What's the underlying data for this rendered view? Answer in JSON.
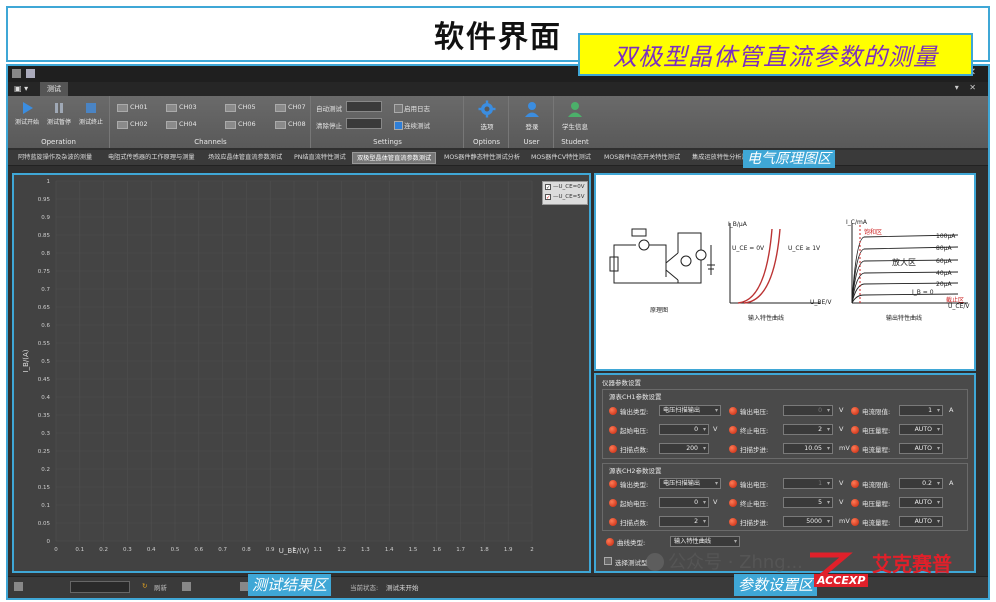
{
  "banner": {
    "title": "软件界面"
  },
  "window": {
    "menu_tab": "测试",
    "controls": "— ⧉ ✕",
    "tab_right": "▾ ✕"
  },
  "ribbon": {
    "operation": {
      "title": "Operation",
      "start": "测试开始",
      "pause": "测试暂停",
      "stop": "测试终止"
    },
    "channels": {
      "title": "Channels",
      "items": [
        "CH01",
        "CH02",
        "CH03",
        "CH04",
        "CH05",
        "CH06",
        "CH07",
        "CH08"
      ]
    },
    "settings": {
      "title": "Settings",
      "auto_test": "自动测试",
      "clear_stop": "清除停止",
      "enable_log": "启用日志",
      "continuous": "连续测试"
    },
    "options": {
      "title": "Options",
      "label": "选项"
    },
    "user": {
      "title": "User",
      "label": "登录"
    },
    "student": {
      "title": "Student",
      "label": "学生信息"
    }
  },
  "headline": "双极型晶体管直流参数的测量",
  "exp_tabs": [
    "阿特蓝旋操作及杂波的测量",
    "电阻式传感器的工作原理与测量",
    "场效应晶体管直流参数测试",
    "PN结直流特性测试",
    "双极型晶体管直流参数测试",
    "MOS器件静态特性测试分析",
    "MOS器件CV特性测试",
    "MOS器件动态开关特性测试",
    "集成运放特性分析测试"
  ],
  "callouts": {
    "circuit": "电气原理图区",
    "results": "测试结果区",
    "params": "参数设置区"
  },
  "plot": {
    "legend": [
      "—U_CE=0V",
      "—U_CE=5V"
    ],
    "legend_colors": [
      "#bbbbbb",
      "#d24040"
    ]
  },
  "chart_data": {
    "type": "line",
    "title": "",
    "xlabel": "U_BE/(V)",
    "ylabel": "I_B/(A)",
    "xlim": [
      0,
      2
    ],
    "ylim": [
      0,
      1
    ],
    "x_ticks": [
      "0",
      "0.1",
      "0.2",
      "0.3",
      "0.4",
      "0.5",
      "0.6",
      "0.7",
      "0.8",
      "0.9",
      "1",
      "1.1",
      "1.2",
      "1.3",
      "1.4",
      "1.5",
      "1.6",
      "1.7",
      "1.8",
      "1.9",
      "2"
    ],
    "y_ticks": [
      "0",
      "0.05",
      "0.1",
      "0.15",
      "0.2",
      "0.25",
      "0.3",
      "0.35",
      "0.4",
      "0.45",
      "0.5",
      "0.55",
      "0.6",
      "0.65",
      "0.7",
      "0.75",
      "0.8",
      "0.85",
      "0.9",
      "0.95",
      "1"
    ],
    "series": [
      {
        "name": "U_CE=0V",
        "color": "#bbbbbb",
        "values": []
      },
      {
        "name": "U_CE=5V",
        "color": "#d24040",
        "values": []
      }
    ],
    "grid": true,
    "legend_position": "top-right"
  },
  "diagram": {
    "left_caption": "原理图",
    "middle_caption": "输入特性曲线",
    "right_caption": "输出特性曲线",
    "uce0": "U_CE = 0V",
    "uce1": "U_CE ≥ 1V",
    "saturation": "饱和区",
    "amplify": "放大区",
    "cutoff": "截止区",
    "ib_labels": [
      "100μA",
      "80μA",
      "60μA",
      "40μA",
      "20μA",
      "I_B = 0"
    ],
    "y_axis_ic": "I_C/mA",
    "y_axis_ib": "I_B/μA",
    "x_axis_ube": "U_BE/V",
    "x_axis_uce": "U_CE/V"
  },
  "params": {
    "title": "仪器参数设置",
    "ch1": {
      "title": "源表CH1参数设置",
      "rows": [
        [
          {
            "label": "输出类型:",
            "value": "电压扫描输出",
            "unit": ""
          },
          {
            "label": "输出电压:",
            "value": "0",
            "unit": "V"
          },
          {
            "label": "电流限值:",
            "value": "1",
            "unit": "A"
          }
        ],
        [
          {
            "label": "起始电压:",
            "value": "0",
            "unit": "V"
          },
          {
            "label": "终止电压:",
            "value": "2",
            "unit": "V"
          },
          {
            "label": "电压量程:",
            "value": "AUTO",
            "unit": ""
          }
        ],
        [
          {
            "label": "扫描点数:",
            "value": "200",
            "unit": ""
          },
          {
            "label": "扫描步进:",
            "value": "10.05",
            "unit": "mV"
          },
          {
            "label": "电流量程:",
            "value": "AUTO",
            "unit": ""
          }
        ]
      ]
    },
    "ch2": {
      "title": "源表CH2参数设置",
      "rows": [
        [
          {
            "label": "输出类型:",
            "value": "电压扫描输出",
            "unit": ""
          },
          {
            "label": "输出电压:",
            "value": "1",
            "unit": "V"
          },
          {
            "label": "电流限值:",
            "value": "0.2",
            "unit": "A"
          }
        ],
        [
          {
            "label": "起始电压:",
            "value": "0",
            "unit": "V"
          },
          {
            "label": "终止电压:",
            "value": "5",
            "unit": "V"
          },
          {
            "label": "电压量程:",
            "value": "AUTO",
            "unit": ""
          }
        ],
        [
          {
            "label": "扫描点数:",
            "value": "2",
            "unit": ""
          },
          {
            "label": "扫描步进:",
            "value": "5000",
            "unit": "mV"
          },
          {
            "label": "电流量程:",
            "value": "AUTO",
            "unit": ""
          }
        ]
      ]
    },
    "curve_type_label": "曲线类型:",
    "curve_type_value": "输入特性曲线",
    "select_test": "选择测试型"
  },
  "statusbar": {
    "refresh": "刷新",
    "status_label": "当前状态:",
    "status_value": "测试未开始"
  },
  "watermark": {
    "wechat": "公众号 · Zhng...",
    "brand": "艾克赛普",
    "logo_text": "ACCEXP"
  }
}
